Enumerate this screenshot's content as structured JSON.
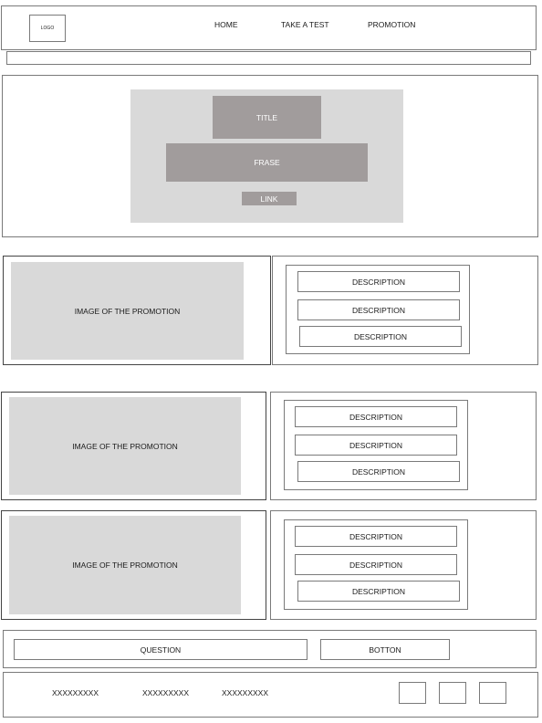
{
  "header": {
    "logo": "LOGO",
    "nav": [
      "HOME",
      "TAKE A TEST",
      "PROMOTION"
    ]
  },
  "hero": {
    "title": "TITLE",
    "phrase": "FRASE",
    "link": "LINK"
  },
  "promotions": [
    {
      "image": "IMAGE OF THE PROMOTION",
      "descriptions": [
        "DESCRIPTION",
        "DESCRIPTION",
        "DESCRIPTION"
      ]
    },
    {
      "image": "IMAGE OF THE PROMOTION",
      "descriptions": [
        "DESCRIPTION",
        "DESCRIPTION",
        "DESCRIPTION"
      ]
    },
    {
      "image": "IMAGE OF THE PROMOTION",
      "descriptions": [
        "DESCRIPTION",
        "DESCRIPTION",
        "DESCRIPTION"
      ]
    }
  ],
  "question_bar": {
    "question": "QUESTION",
    "button": "BOTTON"
  },
  "footer": {
    "links": [
      "XXXXXXXXX",
      "XXXXXXXXX",
      "XXXXXXXXX"
    ]
  }
}
